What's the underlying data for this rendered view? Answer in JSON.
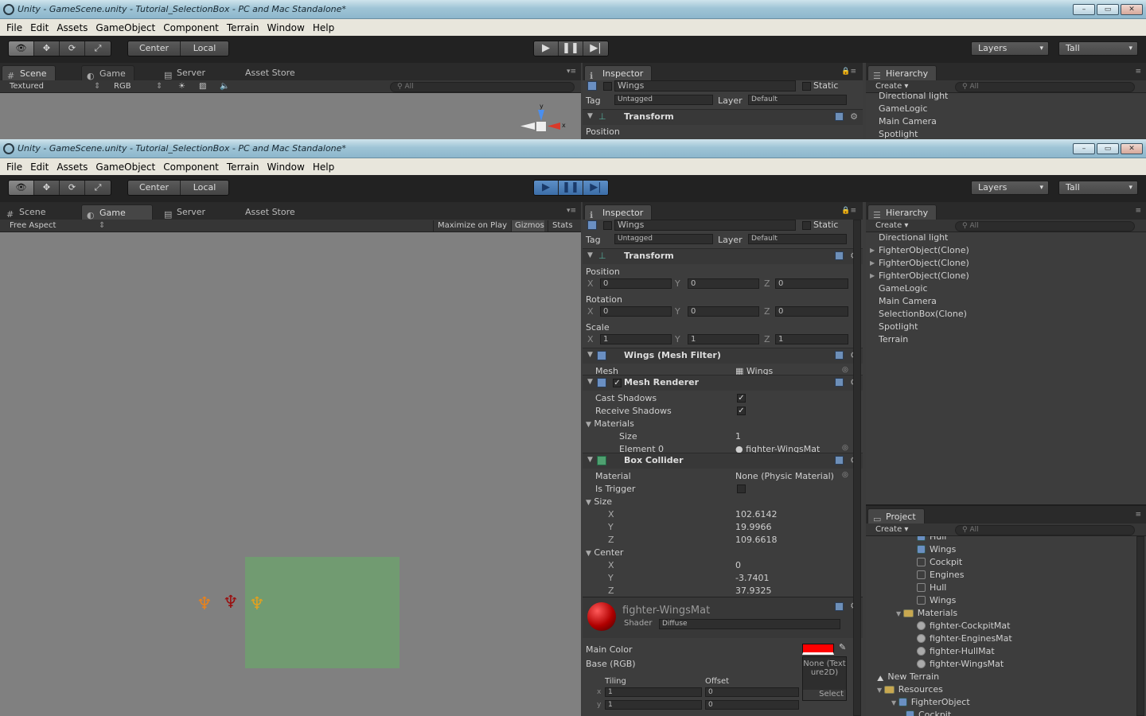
{
  "window": {
    "title": "Unity - GameScene.unity - Tutorial_SelectionBox - PC and Mac Standalone*",
    "controls": {
      "minimize": "–",
      "maximize": "▭",
      "close": "✕"
    }
  },
  "menu": [
    "File",
    "Edit",
    "Assets",
    "GameObject",
    "Component",
    "Terrain",
    "Window",
    "Help"
  ],
  "toolbar": {
    "pivot_center": "Center",
    "pivot_local": "Local",
    "layers": "Layers",
    "layout": "Tall"
  },
  "scene_tabs": {
    "scene": "Scene",
    "game": "Game",
    "server": "Server",
    "asset_store": "Asset Store"
  },
  "scene_bar": {
    "shading": "Textured",
    "render_mode": "RGB",
    "search_placeholder": "All"
  },
  "gizmo": {
    "x_label": "x",
    "y_label": "y"
  },
  "game_bar": {
    "aspect": "Free Aspect",
    "maximize": "Maximize on Play",
    "gizmos": "Gizmos",
    "stats": "Stats"
  },
  "inspector": {
    "tab": "Inspector",
    "object_name": "Wings",
    "static_label": "Static",
    "tag_label": "Tag",
    "tag_value": "Untagged",
    "layer_label": "Layer",
    "layer_value": "Default",
    "transform": {
      "title": "Transform",
      "position_label": "Position",
      "position": {
        "x": "0",
        "y": "0",
        "z": "0"
      },
      "rotation_label": "Rotation",
      "rotation": {
        "x": "0",
        "y": "0",
        "z": "0"
      },
      "scale_label": "Scale",
      "scale": {
        "x": "1",
        "y": "1",
        "z": "1"
      },
      "x": "X",
      "y": "Y",
      "z": "Z"
    },
    "mesh_filter": {
      "title": "Wings (Mesh Filter)",
      "mesh_label": "Mesh",
      "mesh_value": "Wings"
    },
    "mesh_renderer": {
      "title": "Mesh Renderer",
      "cast_shadows": "Cast Shadows",
      "receive_shadows": "Receive Shadows",
      "materials": "Materials",
      "size_label": "Size",
      "size_value": "1",
      "element0_label": "Element 0",
      "element0_value": "fighter-WingsMat"
    },
    "box_collider": {
      "title": "Box Collider",
      "material_label": "Material",
      "material_value": "None (Physic Material)",
      "is_trigger": "Is Trigger",
      "size_label": "Size",
      "size": {
        "x": "102.6142",
        "y": "19.9966",
        "z": "109.6618"
      },
      "center_label": "Center",
      "center": {
        "x": "0",
        "y": "-3.7401",
        "z": "37.9325"
      },
      "x": "X",
      "y": "Y",
      "z": "Z"
    },
    "material": {
      "name": "fighter-WingsMat",
      "shader_label": "Shader",
      "shader_value": "Diffuse",
      "main_color_label": "Main Color",
      "main_color": "#ff0000",
      "base_label": "Base (RGB)",
      "texture_none": "None (Texture2D)",
      "select": "Select",
      "tiling": "Tiling",
      "offset": "Offset",
      "tiling_x": "1",
      "tiling_y": "1",
      "offset_x": "0",
      "offset_y": "0",
      "x": "x",
      "y": "y"
    }
  },
  "hierarchy": {
    "tab": "Hierarchy",
    "create": "Create",
    "search_placeholder": "All",
    "top_items": [
      "Directional light",
      "GameLogic",
      "Main Camera",
      "Spotlight"
    ],
    "items": [
      {
        "label": "Directional light",
        "expandable": false
      },
      {
        "label": "FighterObject(Clone)",
        "expandable": true
      },
      {
        "label": "FighterObject(Clone)",
        "expandable": true
      },
      {
        "label": "FighterObject(Clone)",
        "expandable": true
      },
      {
        "label": "GameLogic",
        "expandable": false
      },
      {
        "label": "Main Camera",
        "expandable": false
      },
      {
        "label": "SelectionBox(Clone)",
        "expandable": false
      },
      {
        "label": "Spotlight",
        "expandable": false
      },
      {
        "label": "Terrain",
        "expandable": false
      }
    ]
  },
  "project": {
    "tab": "Project",
    "create": "Create",
    "search_placeholder": "All",
    "items": [
      {
        "label": "Hull",
        "icon": "cube"
      },
      {
        "label": "Wings",
        "icon": "cube"
      },
      {
        "label": "Cockpit",
        "icon": "mesh"
      },
      {
        "label": "Engines",
        "icon": "mesh"
      },
      {
        "label": "Hull",
        "icon": "mesh"
      },
      {
        "label": "Wings",
        "icon": "mesh"
      },
      {
        "label": "Materials",
        "icon": "folder"
      },
      {
        "label": "fighter-CockpitMat",
        "icon": "sphere"
      },
      {
        "label": "fighter-EnginesMat",
        "icon": "sphere"
      },
      {
        "label": "fighter-HullMat",
        "icon": "sphere"
      },
      {
        "label": "fighter-WingsMat",
        "icon": "sphere"
      },
      {
        "label": "New Terrain",
        "icon": "terrain"
      },
      {
        "label": "Resources",
        "icon": "folder"
      },
      {
        "label": "FighterObject",
        "icon": "cube"
      },
      {
        "label": "Cockpit",
        "icon": "cube"
      }
    ]
  },
  "colors": {
    "selection_box": "#6fa06f",
    "fighter_orange": "#e8821c",
    "fighter_red": "#9a1010",
    "fighter_amber": "#e0a020",
    "play_active": "#3c6ea8"
  }
}
